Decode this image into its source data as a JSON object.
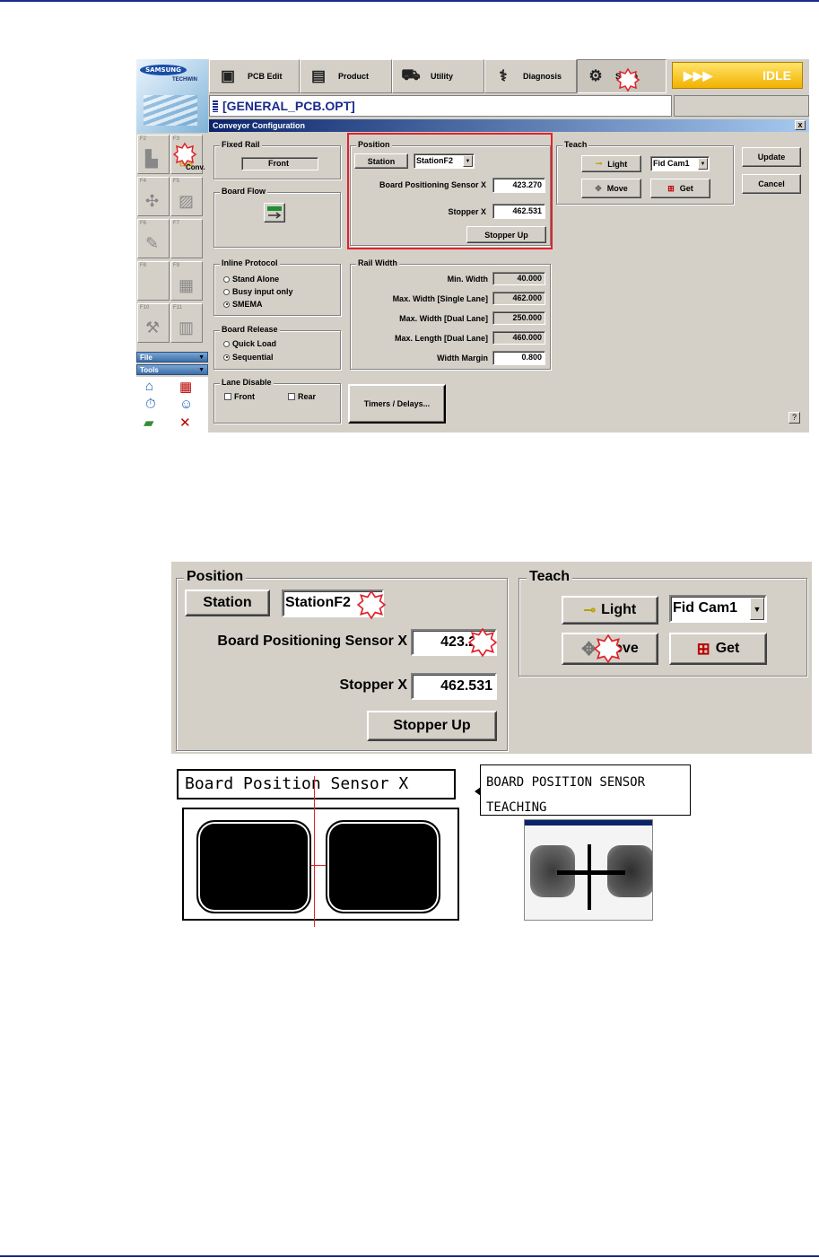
{
  "app": {
    "brand": "SAMSUNG",
    "brand_sub": "TECHWIN",
    "menu": [
      {
        "label": "PCB Edit",
        "icon": "pcb-edit-icon"
      },
      {
        "label": "Product",
        "icon": "product-icon"
      },
      {
        "label": "Utility",
        "icon": "utility-icon"
      },
      {
        "label": "Diagnosis",
        "icon": "diagnosis-icon"
      },
      {
        "label": "Setup",
        "icon": "setup-icon",
        "active": true
      }
    ],
    "status": "IDLE",
    "status_arrows": "▶▶▶",
    "file_title": "[GENERAL_PCB.OPT]",
    "dialog_title": "Conveyor Configuration",
    "dialog_close": "x",
    "fkeys": [
      {
        "key": "F2",
        "label": ""
      },
      {
        "key": "F3",
        "label": "Conv."
      },
      {
        "key": "F4",
        "label": ""
      },
      {
        "key": "F5",
        "label": ""
      },
      {
        "key": "F6",
        "label": ""
      },
      {
        "key": "F7",
        "label": ""
      },
      {
        "key": "F8",
        "label": ""
      },
      {
        "key": "F9",
        "label": ""
      },
      {
        "key": "F10",
        "label": ""
      },
      {
        "key": "F11",
        "label": ""
      }
    ],
    "side_file": "File",
    "side_tools": "Tools",
    "help": "?"
  },
  "dialog": {
    "fixed_rail": {
      "label": "Fixed Rail",
      "value": "Front"
    },
    "board_flow": {
      "label": "Board Flow"
    },
    "inline_protocol": {
      "label": "Inline Protocol",
      "options": [
        "Stand Alone",
        "Busy input only",
        "SMEMA"
      ],
      "selected": "SMEMA"
    },
    "board_release": {
      "label": "Board Release",
      "options": [
        "Quick Load",
        "Sequential"
      ],
      "selected": "Sequential"
    },
    "lane_disable": {
      "label": "Lane Disable",
      "front": "Front",
      "rear": "Rear"
    },
    "position": {
      "label": "Position",
      "station_label": "Station",
      "station_value": "StationF2",
      "sensor_label": "Board  Positioning Sensor X",
      "sensor_value": "423.270",
      "stopper_label": "Stopper  X",
      "stopper_value": "462.531",
      "stopper_button": "Stopper Up"
    },
    "teach": {
      "label": "Teach",
      "light": "Light",
      "camera": "Fid Cam1",
      "move": "Move",
      "get": "Get"
    },
    "rail_width": {
      "label": "Rail Width",
      "rows": [
        {
          "label": "Min. Width",
          "value": "40.000"
        },
        {
          "label": "Max. Width [Single Lane]",
          "value": "462.000"
        },
        {
          "label": "Max. Width [Dual Lane]",
          "value": "250.000"
        },
        {
          "label": "Max. Length [Dual Lane]",
          "value": "460.000"
        },
        {
          "label": "Width Margin",
          "value": "0.800"
        }
      ]
    },
    "update": "Update",
    "cancel": "Cancel",
    "timers": "Timers / Delays..."
  },
  "zoom": {
    "position": "Position",
    "station_label": "Station",
    "station_value": "StationF2",
    "sensor_label": "Board  Positioning Sensor X",
    "sensor_value": "423.270",
    "stopper_label": "Stopper  X",
    "stopper_value": "462.531",
    "stopper_button": "Stopper Up",
    "teach": "Teach",
    "light": "Light",
    "camera": "Fid Cam1",
    "move": "Move",
    "get": "Get"
  },
  "diagram": {
    "sensor_caption": "Board Position Sensor X",
    "teach_line1": "BOARD POSITION SENSOR",
    "teach_line2": "TEACHING"
  }
}
